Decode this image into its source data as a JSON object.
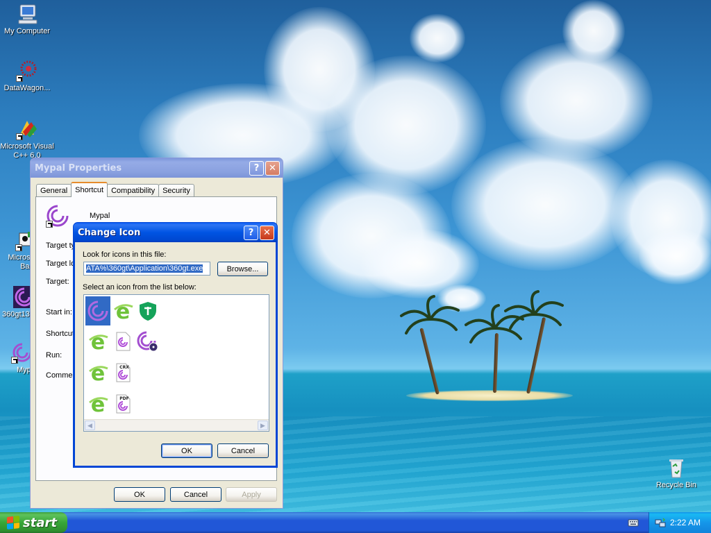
{
  "desktop": {
    "icons": [
      {
        "label": "My Computer"
      },
      {
        "label": "DataWagon..."
      },
      {
        "label": "Microsoft Visual C++ 6.0"
      },
      {
        "label": "Microsoft Basic"
      },
      {
        "label": "360gt13"
      },
      {
        "label": "Myp"
      },
      {
        "label": "Recycle Bin"
      }
    ]
  },
  "properties_window": {
    "title": "Mypal Properties",
    "tabs": [
      "General",
      "Shortcut",
      "Compatibility",
      "Security"
    ],
    "selected_tab": "Shortcut",
    "app_name": "Mypal",
    "fields": {
      "target_type": "Target ty",
      "target_location": "Target lo",
      "target": "Target:",
      "start_in": "Start in:",
      "shortcut_key": "Shortcut",
      "run": "Run:",
      "comment": "Commen"
    },
    "buttons": {
      "ok": "OK",
      "cancel": "Cancel",
      "apply": "Apply"
    }
  },
  "change_icon_dialog": {
    "title": "Change Icon",
    "look_label": "Look for icons in this file:",
    "file_path": "ATA%\\360gt\\Application\\360gt.exe",
    "browse_label": "Browse...",
    "list_label": "Select an icon from the list below:",
    "icons": [
      {
        "name": "mypal-swirl-icon",
        "badge": ""
      },
      {
        "name": "green-e-browser-icon",
        "badge": ""
      },
      {
        "name": "green-shield-icon",
        "badge": ""
      },
      {
        "name": "green-e-browser-icon",
        "badge": ""
      },
      {
        "name": "document-swirl-icon",
        "badge": ""
      },
      {
        "name": "mypal-swirl-cd-icon",
        "badge": ""
      },
      {
        "name": "green-e-browser-icon",
        "badge": ""
      },
      {
        "name": "crx-document-icon",
        "badge": "CRX"
      },
      {
        "name": "green-e-browser-icon",
        "badge": ""
      },
      {
        "name": "pdf-document-icon",
        "badge": "PDF"
      }
    ],
    "selected_icon": 0,
    "buttons": {
      "ok": "OK",
      "cancel": "Cancel"
    }
  },
  "taskbar": {
    "start_label": "start",
    "clock": "2:22 AM"
  },
  "colors": {
    "titlebar_active": "#0054e3",
    "start_green": "#37a737",
    "tray_blue": "#1596e9",
    "selection_blue": "#316ac5",
    "mypal_purple": "#8a3bbf",
    "ie_green": "#6fc33a"
  }
}
